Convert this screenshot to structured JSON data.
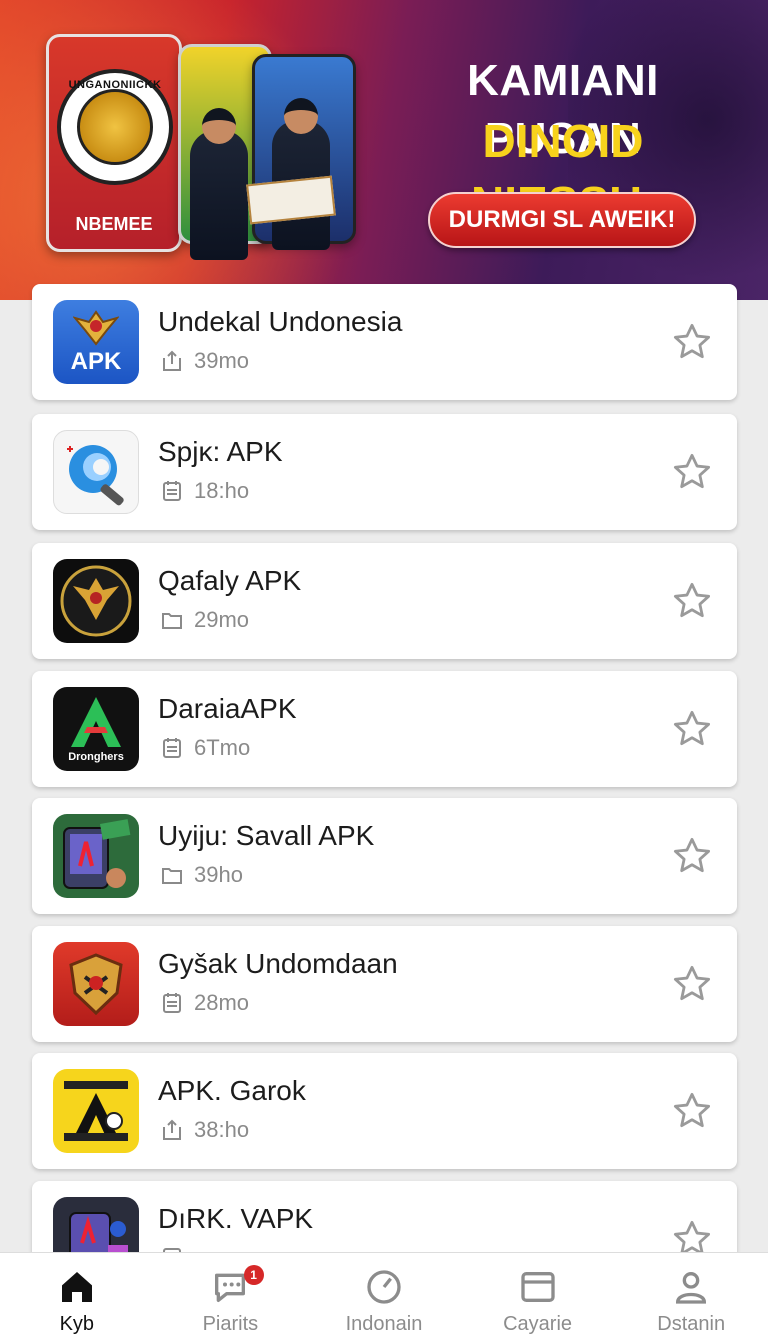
{
  "banner": {
    "phone_label": "NBEMEE",
    "seal_text": "UNGANONIICKK",
    "title_line1": "KAMIANI PUSAN",
    "title_line2": "DINOID NIESSH.",
    "cta_label": "DURMGI SL AWEIK!",
    "colors": {
      "title2": "#f7d21c",
      "cta": "#d9261f"
    }
  },
  "apps": [
    {
      "name": "Undekal Undonesia",
      "meta": "39mo",
      "meta_icon": "share-icon",
      "icon": "garuda-apk-icon",
      "icon_label": "APK"
    },
    {
      "name": "Spjĸ: APK",
      "meta": "18:ho",
      "meta_icon": "document-icon",
      "icon": "blue-swirl-icon",
      "icon_label": ""
    },
    {
      "name": "Qafaly APK",
      "meta": "29mo",
      "meta_icon": "folder-icon",
      "icon": "garuda-seal-icon",
      "icon_label": ""
    },
    {
      "name": "DaraiaAPK",
      "meta": "6Tmo",
      "meta_icon": "document-icon",
      "icon": "green-a-icon",
      "icon_label": "Dronghers"
    },
    {
      "name": "Uyiju: Savall APK",
      "meta": "39ho",
      "meta_icon": "folder-icon",
      "icon": "phone-card-icon",
      "icon_label": ""
    },
    {
      "name": "Gyšak Undomdaan",
      "meta": "28mo",
      "meta_icon": "document-icon",
      "icon": "shield-icon",
      "icon_label": ""
    },
    {
      "name": "APK. Garok",
      "meta": "38:ho",
      "meta_icon": "share-icon",
      "icon": "yellow-a-icon",
      "icon_label": ""
    },
    {
      "name": "DıRK. VAPK",
      "meta": "",
      "meta_icon": "document-icon",
      "icon": "phone-puzzle-icon",
      "icon_label": ""
    }
  ],
  "nav": [
    {
      "label": "Kyb",
      "icon": "home-icon",
      "active": true
    },
    {
      "label": "Piarits",
      "icon": "chat-icon",
      "badge": "1"
    },
    {
      "label": "Indonain",
      "icon": "gauge-icon"
    },
    {
      "label": "Cayarie",
      "icon": "browser-icon"
    },
    {
      "label": "Dstanin",
      "icon": "user-icon"
    }
  ]
}
